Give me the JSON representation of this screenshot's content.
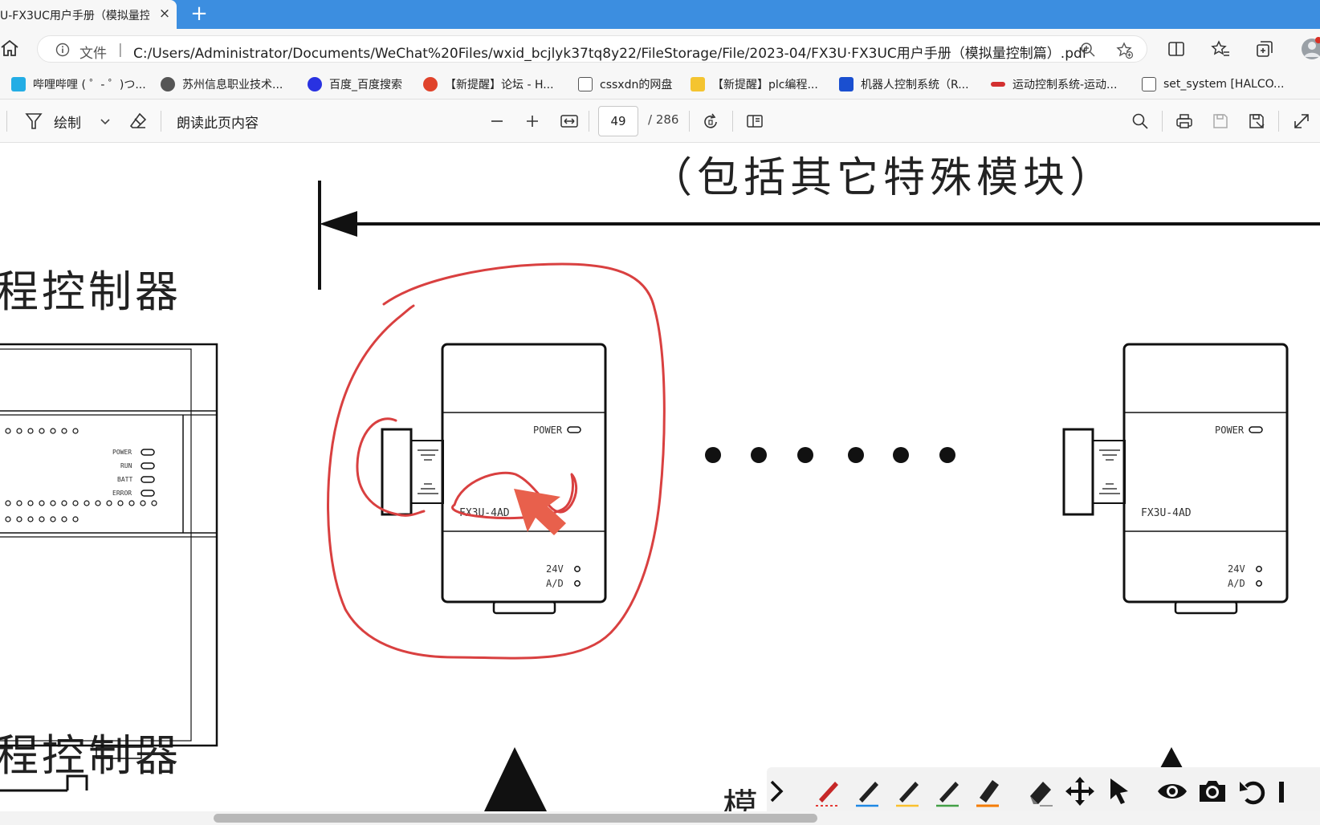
{
  "tab": {
    "title": "U-FX3UC用户手册（模拟量控",
    "close_label": "×",
    "new_tab_label": "+"
  },
  "address_bar": {
    "file_label": "文件",
    "separator": "|",
    "url": "C:/Users/Administrator/Documents/WeChat%20Files/wxid_bcjlyk37tq8y22/FileStorage/File/2023-04/FX3U·FX3UC用户手册（模拟量控制篇）.pdf"
  },
  "bookmarks": [
    {
      "label": "哔哩哔哩 ( ゜- ゜)つ...",
      "icon": "bilibili-icon",
      "color": "#23ade5"
    },
    {
      "label": "苏州信息职业技术...",
      "icon": "globe-icon",
      "color": "#555555"
    },
    {
      "label": "百度_百度搜索",
      "icon": "baidu-paw-icon",
      "color": "#2932e1"
    },
    {
      "label": "【新提醒】论坛 - H...",
      "icon": "forum-icon",
      "color": "#e0432b"
    },
    {
      "label": "cssxdn的网盘",
      "icon": "page-icon",
      "color": "#555555"
    },
    {
      "label": "【新提醒】plc编程...",
      "icon": "folder-icon",
      "color": "#f4c430"
    },
    {
      "label": "机器人控制系统（R...",
      "icon": "r-logo-icon",
      "color": "#1a4fd0"
    },
    {
      "label": "运动控制系统-运动...",
      "icon": "brand-icon",
      "color": "#d33030"
    },
    {
      "label": "set_system [HALCO...",
      "icon": "page-icon",
      "color": "#555555"
    }
  ],
  "pdf_toolbar": {
    "draw_label": "绘制",
    "read_aloud_label": "朗读此页内容",
    "current_page": "49",
    "total_pages": "/ 286"
  },
  "document": {
    "heading": "（包括其它特殊模块）",
    "plc_label_1": "程控制器",
    "plc_label_2": "程控制器",
    "partial_label": "模",
    "module_left": {
      "model": "FX3U-4AD",
      "power": "POWER",
      "v24": "24V",
      "ad": "A/D"
    },
    "module_right": {
      "model": "FX3U-4AD",
      "power": "POWER",
      "v24": "24V",
      "ad": "A/D"
    },
    "plc_leds": [
      "POWER",
      "RUN",
      "BATT",
      "ERROR"
    ]
  },
  "colors": {
    "tabstrip": "#3c8ee0",
    "annotation_red": "#d94040",
    "arrow_fill": "#e8604c"
  }
}
